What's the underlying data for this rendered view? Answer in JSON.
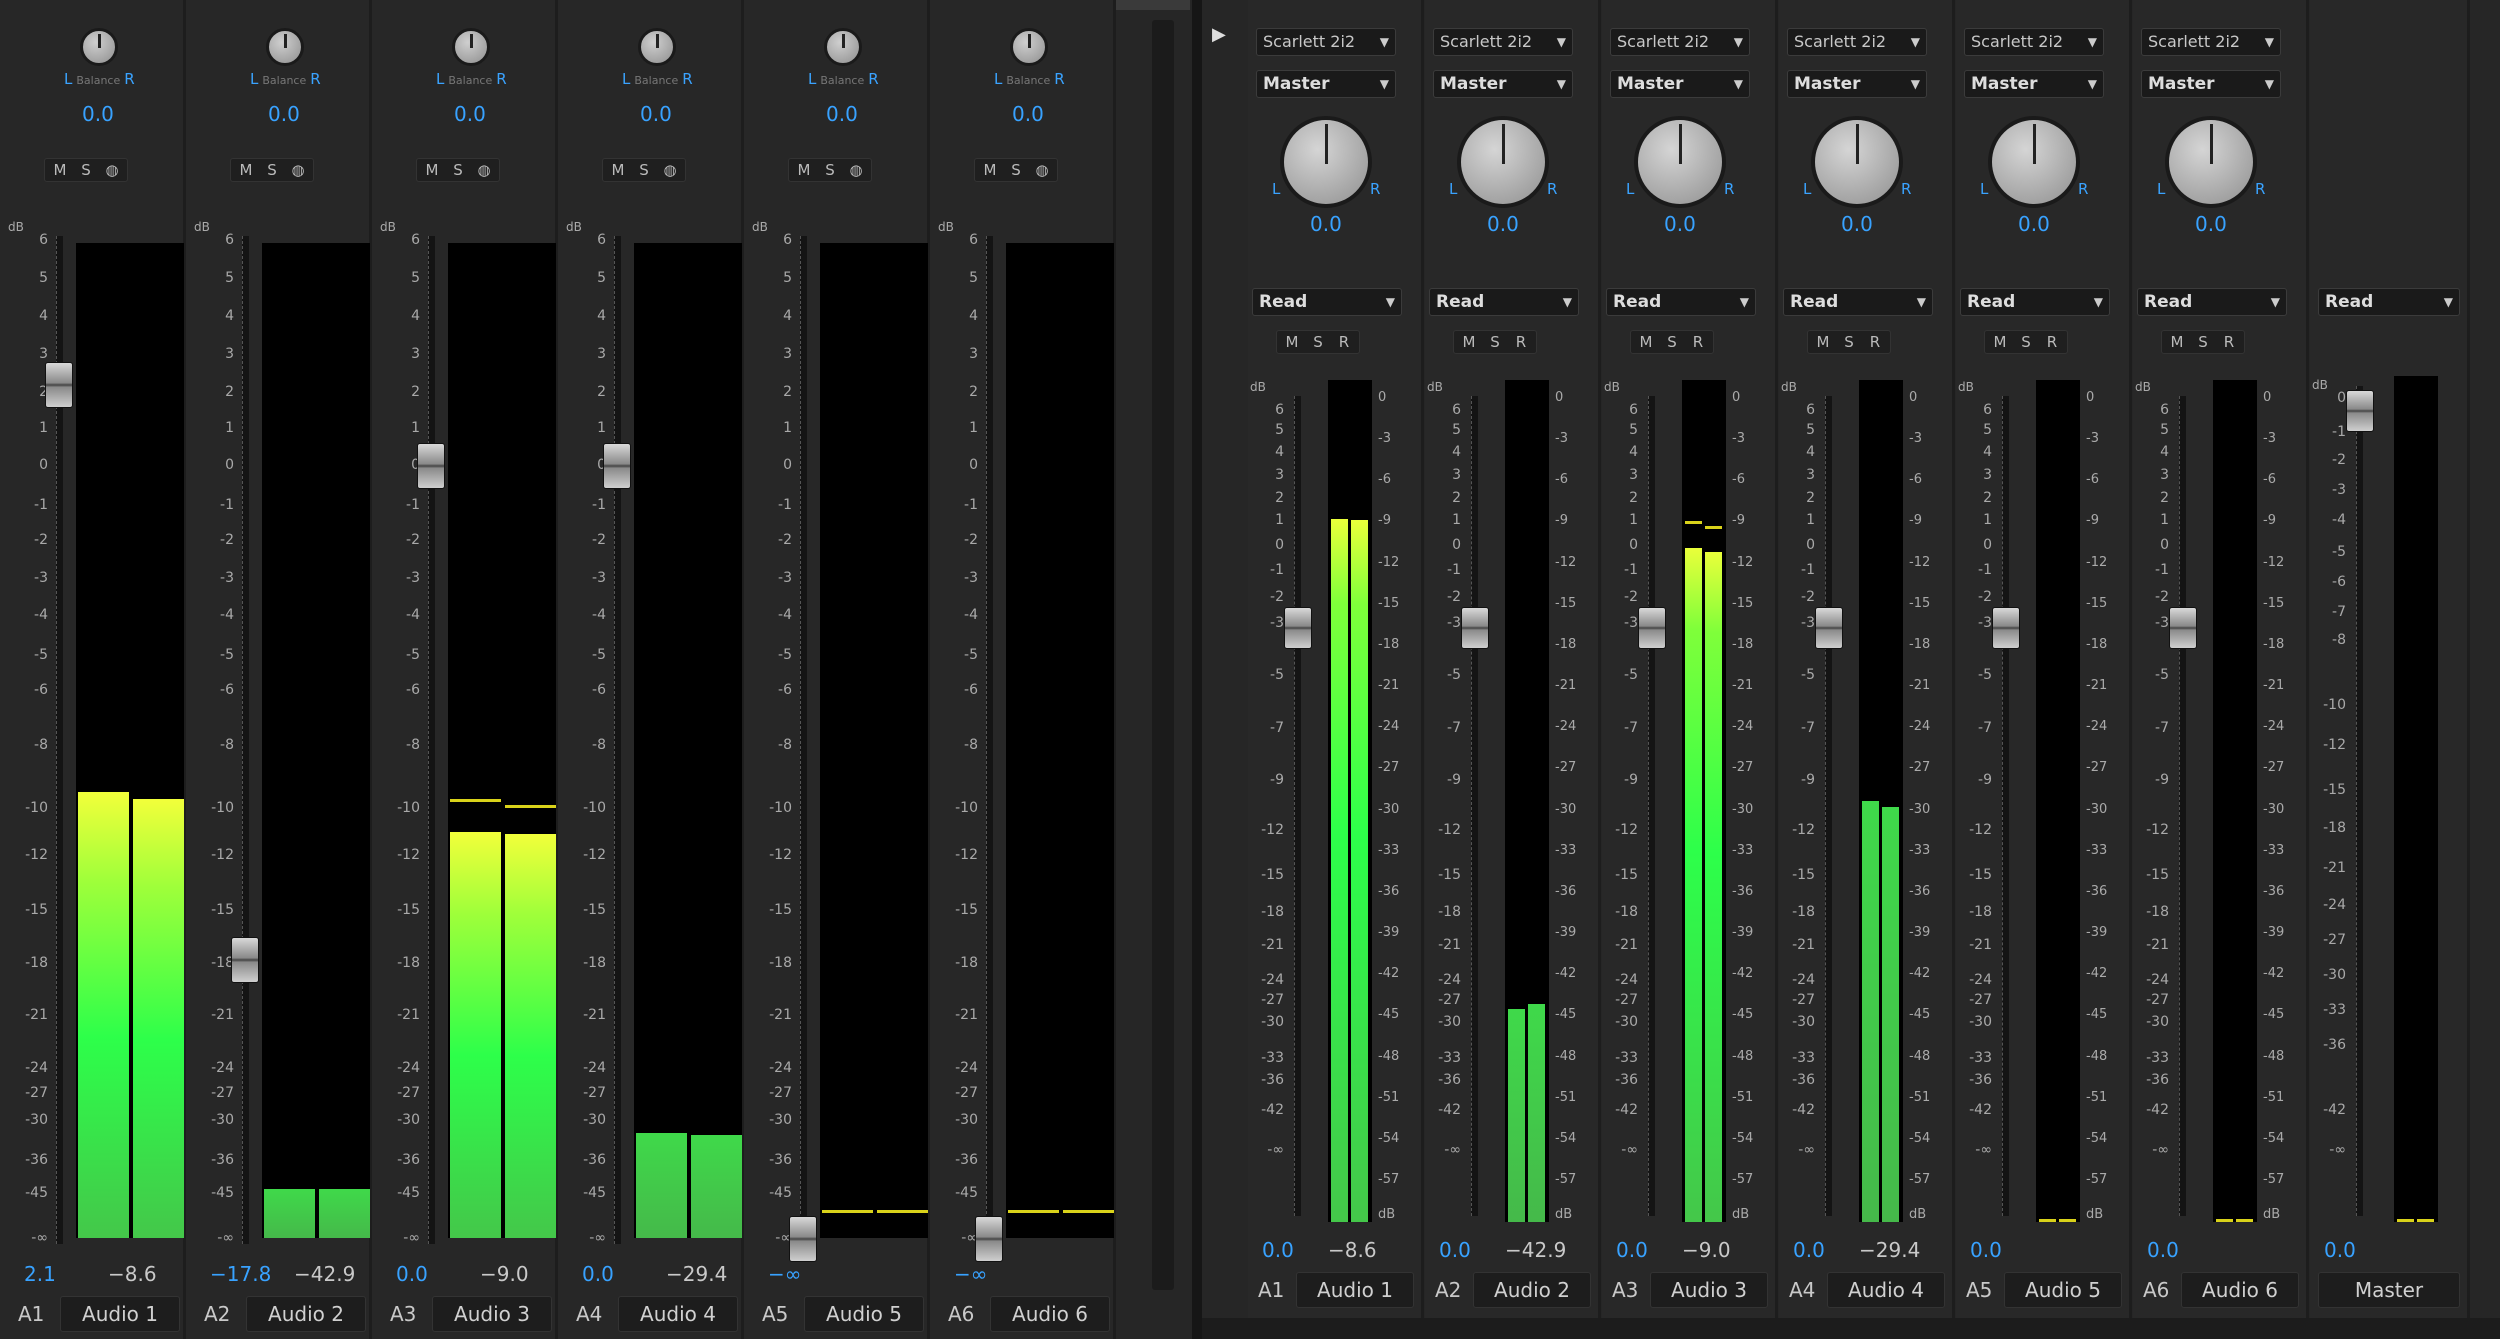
{
  "left_mixer": {
    "clips": [
      {
        "track": "A1",
        "name": "Audio 1",
        "pan": "0.0",
        "vol": "2.1",
        "level": "−8.6",
        "fader_db": 2.2,
        "meter_l": -9.5,
        "meter_r": -9.7,
        "peak_l": null,
        "peak_r": null
      },
      {
        "track": "A2",
        "name": "Audio 2",
        "pan": "0.0",
        "vol": "−17.8",
        "level": "−42.9",
        "fader_db": -17.8,
        "meter_l": -44,
        "meter_r": -44,
        "peak_l": null,
        "peak_r": null
      },
      {
        "track": "A3",
        "name": "Audio 3",
        "pan": "0.0",
        "vol": "0.0",
        "level": "−9.0",
        "fader_db": 0,
        "meter_l": -11,
        "meter_r": -11.1,
        "peak_l": -9.7,
        "peak_r": -9.9
      },
      {
        "track": "A4",
        "name": "Audio 4",
        "pan": "0.0",
        "vol": "0.0",
        "level": "−29.4",
        "fader_db": 0,
        "meter_l": -32,
        "meter_r": -32.2,
        "peak_l": null,
        "peak_r": null
      },
      {
        "track": "A5",
        "name": "Audio 5",
        "pan": "0.0",
        "vol": "−∞",
        "level": "",
        "fader_db": "-inf",
        "meter_l": null,
        "meter_r": null,
        "peak_l": -48,
        "peak_r": -48
      },
      {
        "track": "A6",
        "name": "Audio 6",
        "pan": "0.0",
        "vol": "−∞",
        "level": "",
        "fader_db": "-inf",
        "meter_l": null,
        "meter_r": null,
        "peak_l": -48,
        "peak_r": -48
      }
    ],
    "msb_labels": [
      "M",
      "S",
      "◍"
    ],
    "lr_label": {
      "l": "L",
      "bal": "Balance",
      "r": "R"
    }
  },
  "right_mixer": {
    "tracks": [
      {
        "track": "A1",
        "name": "Audio 1",
        "output": "Scarlett 2i2",
        "send": "Master",
        "pan": "0.0",
        "mode": "Read",
        "vol": "0.0",
        "level": "−8.6",
        "meter_l": -8.8,
        "meter_r": -8.9,
        "peak_l": null,
        "peak_r": null
      },
      {
        "track": "A2",
        "name": "Audio 2",
        "output": "Scarlett 2i2",
        "send": "Master",
        "pan": "0.0",
        "mode": "Read",
        "vol": "0.0",
        "level": "−42.9",
        "meter_l": -44.5,
        "meter_r": -44.2,
        "peak_l": null,
        "peak_r": null
      },
      {
        "track": "A3",
        "name": "Audio 3",
        "output": "Scarlett 2i2",
        "send": "Master",
        "pan": "0.0",
        "mode": "Read",
        "vol": "0.0",
        "level": "−9.0",
        "meter_l": -10.9,
        "meter_r": -11.2,
        "peak_l": -9.0,
        "peak_r": -9.3
      },
      {
        "track": "A4",
        "name": "Audio 4",
        "output": "Scarlett 2i2",
        "send": "Master",
        "pan": "0.0",
        "mode": "Read",
        "vol": "0.0",
        "level": "−29.4",
        "meter_l": -29.4,
        "meter_r": -29.8,
        "peak_l": null,
        "peak_r": null
      },
      {
        "track": "A5",
        "name": "Audio 5",
        "output": "Scarlett 2i2",
        "send": "Master",
        "pan": "0.0",
        "mode": "Read",
        "vol": "0.0",
        "level": "",
        "meter_l": null,
        "meter_r": null,
        "peak_l": -60,
        "peak_r": -60
      },
      {
        "track": "A6",
        "name": "Audio 6",
        "output": "Scarlett 2i2",
        "send": "Master",
        "pan": "0.0",
        "mode": "Read",
        "vol": "0.0",
        "level": "",
        "meter_l": null,
        "meter_r": null,
        "peak_l": -60,
        "peak_r": -60
      }
    ],
    "master": {
      "name": "Master",
      "mode": "Read",
      "vol": "0.0",
      "fader_db": 0
    },
    "msr_labels": [
      "M",
      "S",
      "R"
    ],
    "lr_label": {
      "l": "L",
      "r": "R"
    },
    "vu_scale_label": "dB"
  },
  "scales": {
    "left_fader": [
      "dB",
      "6",
      "5",
      "4",
      "3",
      "2",
      "1",
      "0",
      "-1",
      "-2",
      "-3",
      "-4",
      "-5",
      "-6",
      "-8",
      "-10",
      "-12",
      "-15",
      "-18",
      "-21",
      "-24",
      "-27",
      "-30",
      "-36",
      "-45",
      "-∞"
    ],
    "right_fader": [
      "dB",
      "6",
      "5",
      "4",
      "3",
      "2",
      "1",
      "0",
      "-1",
      "-2",
      "-3",
      "-5",
      "-7",
      "-9",
      "-12",
      "-15",
      "-18",
      "-21",
      "-24",
      "-27",
      "-30",
      "-33",
      "-36",
      "-42",
      "-∞"
    ],
    "right_vu": [
      "0",
      "-3",
      "-6",
      "-9",
      "-12",
      "-15",
      "-18",
      "-21",
      "-24",
      "-27",
      "-30",
      "-33",
      "-36",
      "-39",
      "-42",
      "-45",
      "-48",
      "-51",
      "-54",
      "-57",
      "dB"
    ],
    "master_fader": [
      "dB",
      "0",
      "-1",
      "-2",
      "-3",
      "-4",
      "-5",
      "-6",
      "-7",
      "-8",
      "-10",
      "-12",
      "-15",
      "-18",
      "-21",
      "-24",
      "-27",
      "-30",
      "-33",
      "-36",
      "-42",
      "-∞"
    ]
  },
  "colors": {
    "accent": "#38a2ff",
    "meter_low": "#3fbf3f",
    "meter_mid": "#2fff4a",
    "meter_high": "#f0ff3a",
    "peak": "#d9d21a"
  }
}
